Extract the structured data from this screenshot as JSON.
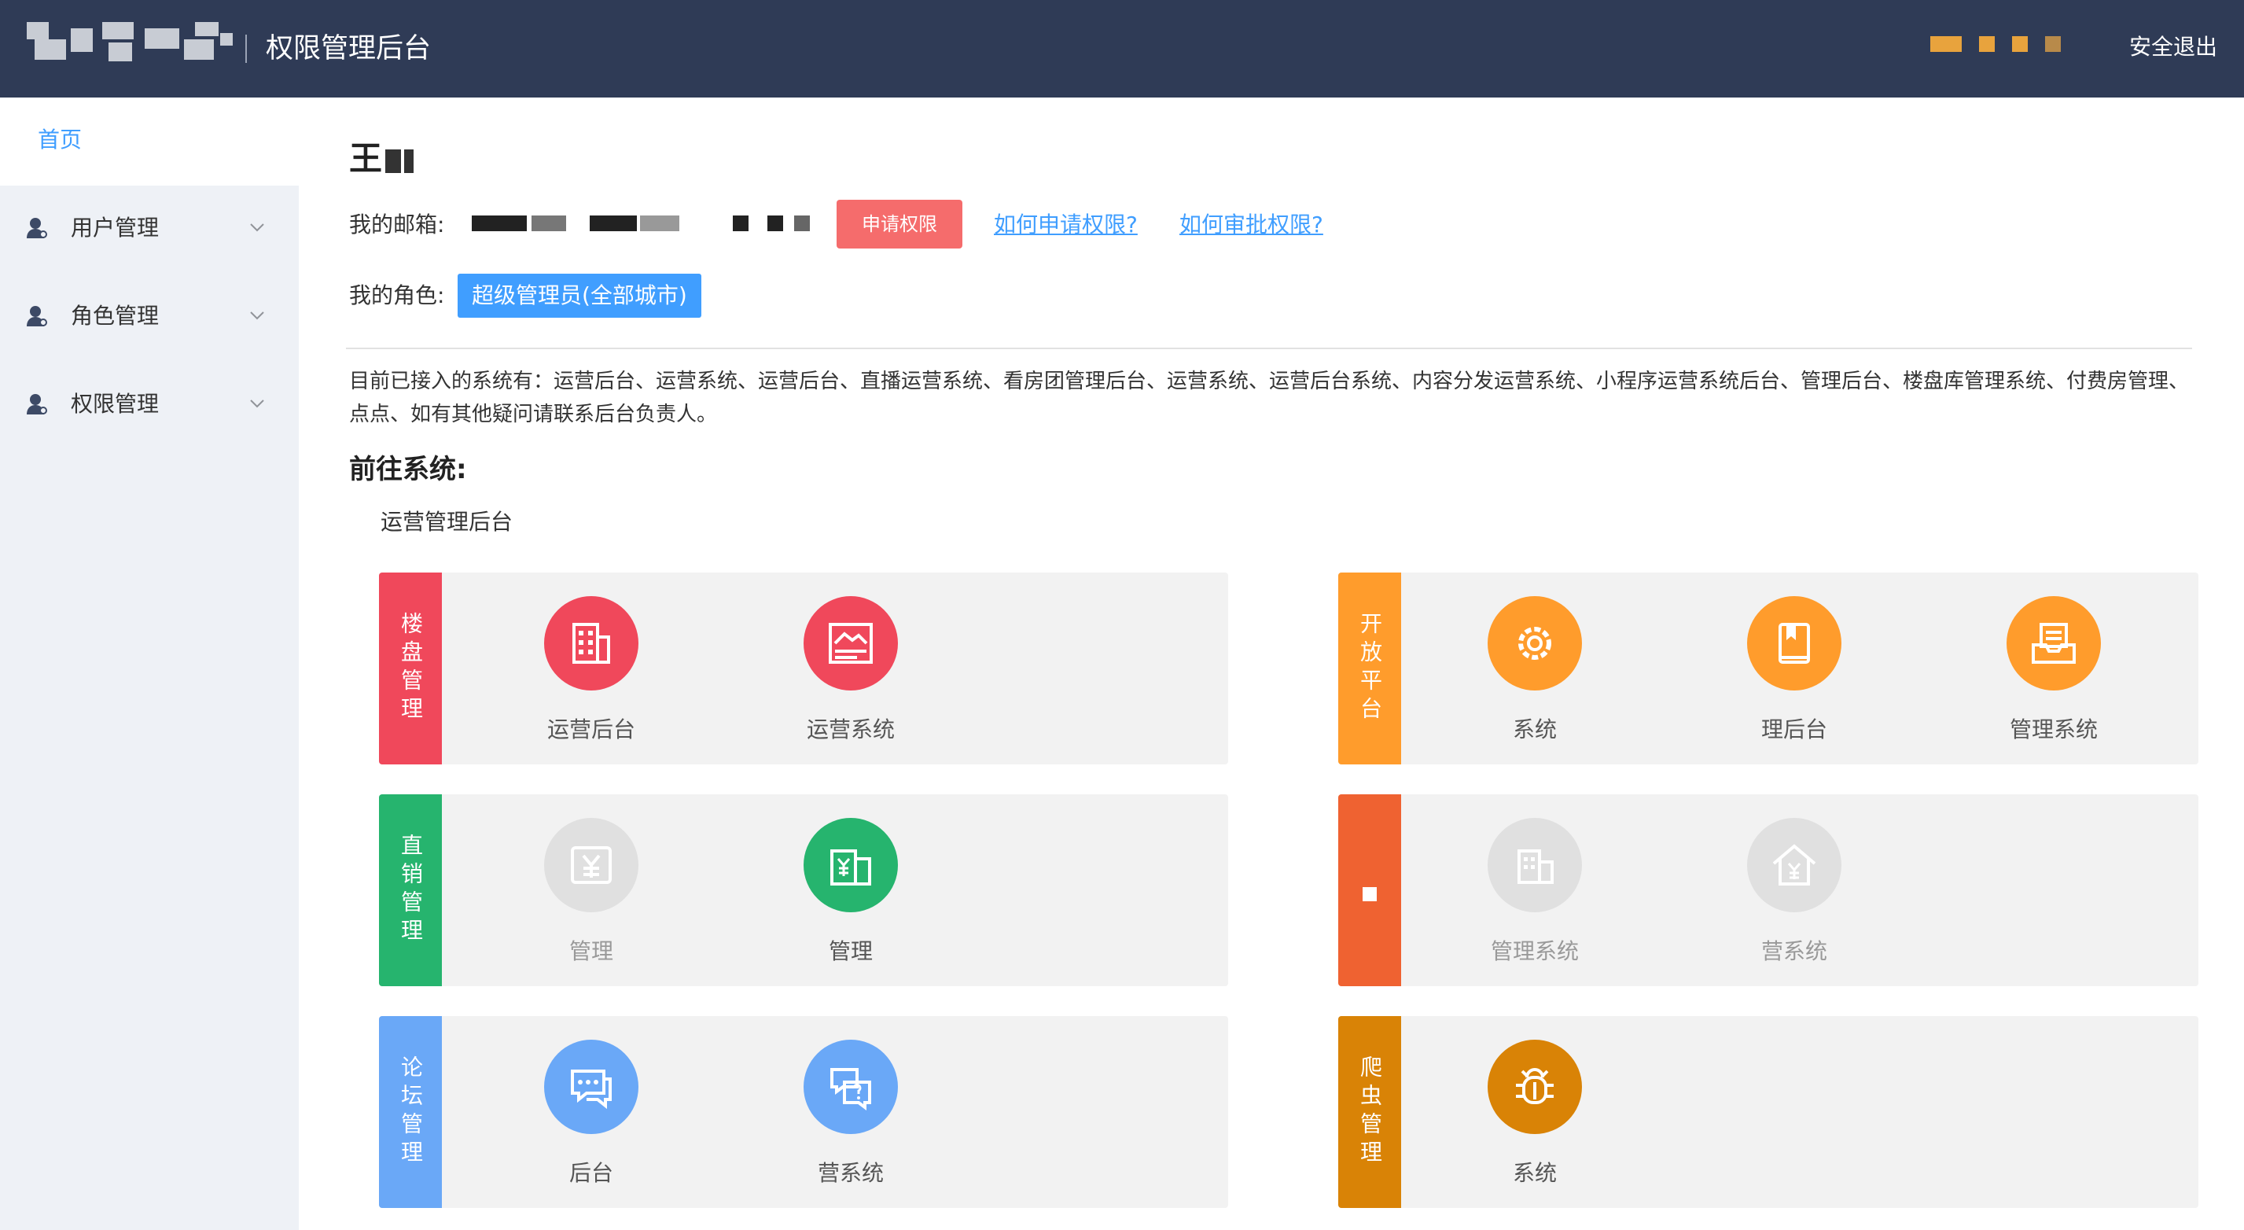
{
  "header": {
    "title": "权限管理后台",
    "logout": "安全退出"
  },
  "sidebar": {
    "home": "首页",
    "items": [
      {
        "label": "用户管理"
      },
      {
        "label": "角色管理"
      },
      {
        "label": "权限管理"
      }
    ]
  },
  "profile": {
    "name": "王",
    "email_label": "我的邮箱:",
    "apply_button": "申请权限",
    "how_apply": "如何申请权限?",
    "how_approve": "如何审批权限?",
    "role_label": "我的角色:",
    "role_badge": "超级管理员(全部城市)"
  },
  "intro": "目前已接入的系统有：运营后台、运营系统、运营后台、直播运营系统、看房团管理后台、运营系统、运营后台系统、内容分发运营系统、小程序运营系统后台、管理后台、楼盘库管理系统、付费房管理、点点、如有其他疑问请联系后台负责人。",
  "goto_title": "前往系统:",
  "system_group": "运营管理后台",
  "colors": {
    "header_bg": "#2f3b56",
    "accent": "#409eff",
    "danger": "#f56c6c"
  },
  "categories": [
    {
      "name": "楼盘管理",
      "color": "#f0485b",
      "items": [
        {
          "label": "运营后台",
          "icon": "building-icon",
          "enabled": true
        },
        {
          "label": "运营系统",
          "icon": "dashboard-icon",
          "enabled": true
        }
      ]
    },
    {
      "name": "开放平台",
      "color": "#ff9c2c",
      "items": [
        {
          "label": "系统",
          "icon": "gear-icon",
          "enabled": true
        },
        {
          "label": "理后台",
          "icon": "book-icon",
          "enabled": true
        },
        {
          "label": "管理系统",
          "icon": "inbox-icon",
          "enabled": true
        }
      ]
    },
    {
      "name": "直销管理",
      "color": "#26b46e",
      "items": [
        {
          "label": "管理",
          "icon": "money-icon",
          "enabled": false
        },
        {
          "label": "管理",
          "icon": "money-building-icon",
          "enabled": true
        }
      ]
    },
    {
      "name": "",
      "color": "#ef6231",
      "items": [
        {
          "label": "管理系统",
          "icon": "office-icon",
          "enabled": false
        },
        {
          "label": "营系统",
          "icon": "house-money-icon",
          "enabled": false
        }
      ]
    },
    {
      "name": "论坛管理",
      "color": "#6aa8f7",
      "items": [
        {
          "label": "后台",
          "icon": "chat-icon",
          "enabled": true
        },
        {
          "label": "营系统",
          "icon": "question-chat-icon",
          "enabled": true
        }
      ]
    },
    {
      "name": "爬虫管理",
      "color": "#d98306",
      "items": [
        {
          "label": "系统",
          "icon": "bug-icon",
          "enabled": true
        }
      ]
    }
  ]
}
